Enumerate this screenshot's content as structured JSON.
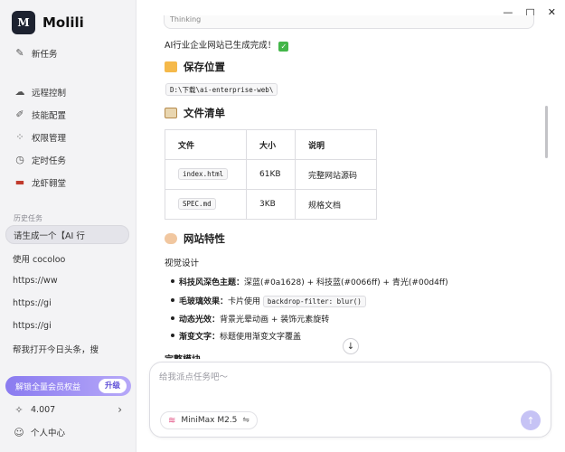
{
  "app": {
    "name": "Molili",
    "logo_text": "M"
  },
  "sidebar": {
    "new_task": "新任务",
    "items": [
      {
        "label": "远程控制",
        "icon": "cloud-icon"
      },
      {
        "label": "技能配置",
        "icon": "pen-icon"
      },
      {
        "label": "权限管理",
        "icon": "grid-icon"
      },
      {
        "label": "定时任务",
        "icon": "clock-icon"
      },
      {
        "label": "龙虾翱堂",
        "icon": "lobster-icon"
      }
    ],
    "history_label": "历史任务",
    "history": [
      "请生成一个【AI 行",
      "使用 cocoloo",
      "https://ww",
      "https://gi",
      "https://gi",
      "帮我打开今日头条，搜"
    ],
    "upgrade_text": "解锁全量会员权益",
    "upgrade_button": "升级",
    "credits": "4.007",
    "user_center": "个人中心"
  },
  "window_controls": {
    "minimize": "—",
    "maximize": "□",
    "close": "✕"
  },
  "content": {
    "top_snippet": "Thinking",
    "done_text": "AI行业企业网站已生成完成！",
    "save_heading": "保存位置",
    "save_path": "D:\\下载\\ai-enterprise-web\\",
    "files_heading": "文件清单",
    "table": {
      "headers": [
        "文件",
        "大小",
        "说明"
      ],
      "rows": [
        [
          "index.html",
          "61KB",
          "完整网站源码"
        ],
        [
          "SPEC.md",
          "3KB",
          "规格文档"
        ]
      ]
    },
    "features_heading": "网站特性",
    "visual_heading": "视觉设计",
    "bullets": [
      {
        "bold": "科技风深色主题：",
        "text": "深蓝(#0a1628) + 科技蓝(#0066ff) + 青光(#00d4ff)",
        "code": ""
      },
      {
        "bold": "毛玻璃效果：",
        "text": "卡片使用 ",
        "code": "backdrop-filter: blur()"
      },
      {
        "bold": "动态光效：",
        "text": "背景光晕动画 + 装饰元素旋转",
        "code": ""
      },
      {
        "bold": "渐变文字：",
        "text": "标题使用渐变文字覆盖",
        "code": ""
      }
    ],
    "cutoff_heading": "完整模块"
  },
  "composer": {
    "placeholder": "给我派点任务吧～",
    "model": "MiniMax M2.5"
  },
  "colors": {
    "accent": "#8a7bf0",
    "check": "#43b649",
    "send": "#c6c3f5"
  }
}
